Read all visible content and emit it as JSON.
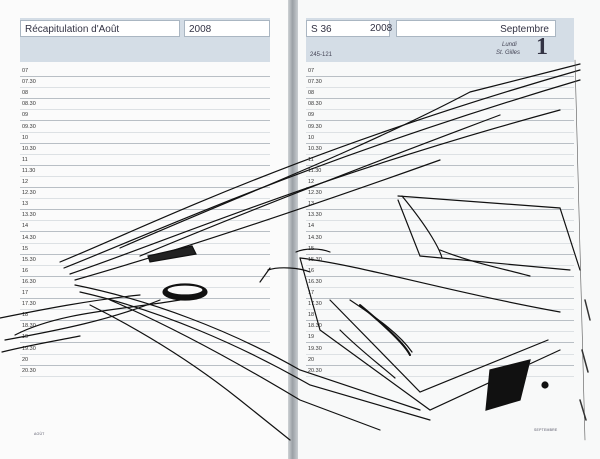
{
  "left_page": {
    "title": "Récapitulation d'Août",
    "year": "2008",
    "footer_month": "AOÛT"
  },
  "right_page": {
    "week": "S 36",
    "year": "2008",
    "month": "Septembre",
    "day_counter": "245-121",
    "weekday": "Lundi",
    "saint": "St. Gilles",
    "day_number": "1",
    "footer_month": "SEPTEMBRE"
  },
  "hours": [
    "07",
    "07.30",
    "08",
    "08.30",
    "09",
    "09.30",
    "10",
    "10.30",
    "11",
    "11.30",
    "12",
    "12.30",
    "13",
    "13.30",
    "14",
    "14.30",
    "15",
    "15.30",
    "16",
    "16.30",
    "17",
    "17.30",
    "18",
    "18.30",
    "19",
    "19.30",
    "20",
    "20.30"
  ],
  "colors": {
    "header_band": "#d4dde6",
    "ink": "#111111",
    "rule": "#b9bfc5"
  }
}
